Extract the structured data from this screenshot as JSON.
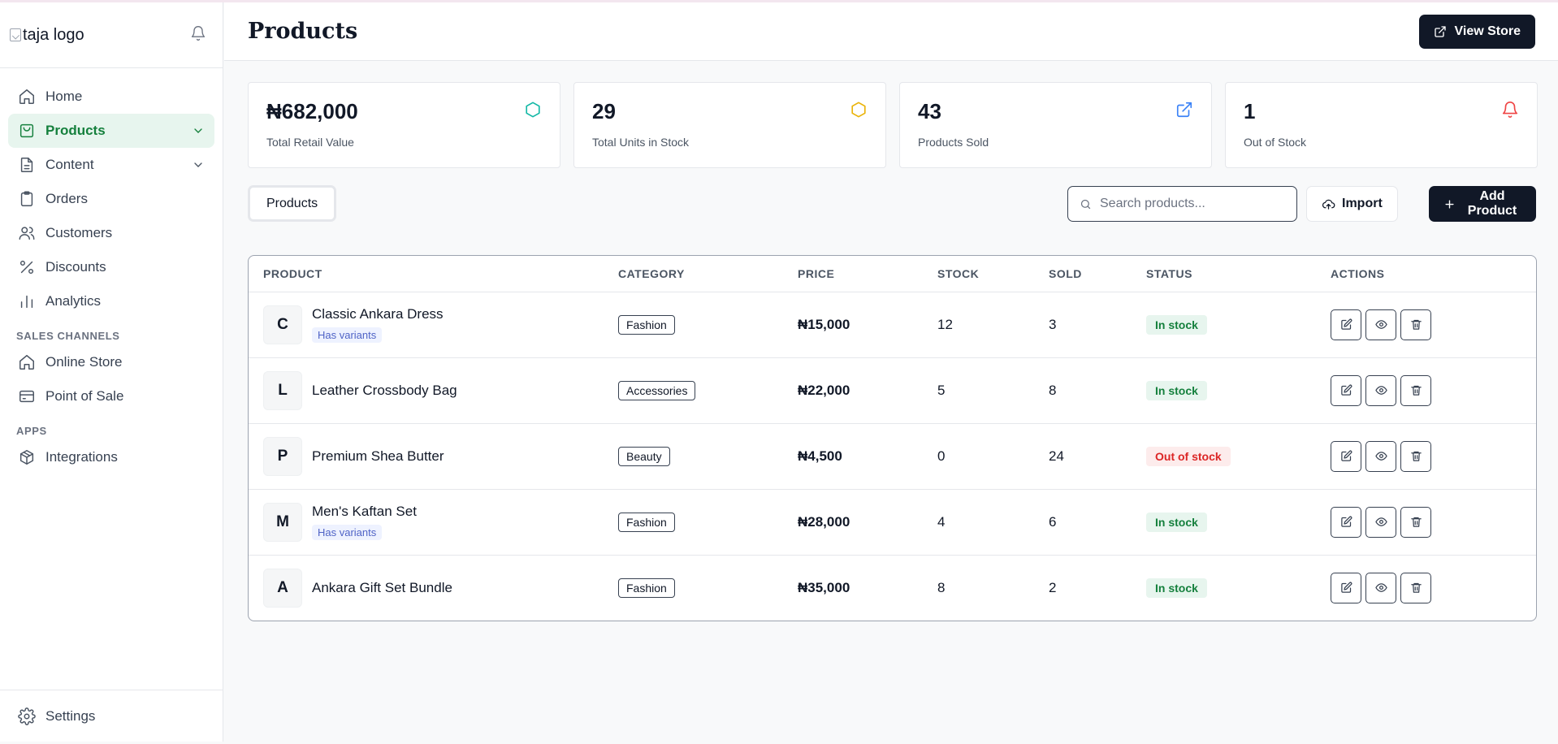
{
  "sidebar": {
    "logo_alt": "taja logo",
    "items": [
      {
        "label": "Home",
        "icon": "home-icon"
      },
      {
        "label": "Products",
        "icon": "bag-icon",
        "active": true
      },
      {
        "label": "Content",
        "icon": "document-icon"
      },
      {
        "label": "Orders",
        "icon": "clipboard-icon"
      },
      {
        "label": "Customers",
        "icon": "users-icon"
      },
      {
        "label": "Discounts",
        "icon": "percent-icon"
      },
      {
        "label": "Analytics",
        "icon": "bar-chart-icon"
      }
    ],
    "sales_channels_title": "SALES CHANNELS",
    "sales_channels": [
      {
        "label": "Online Store",
        "icon": "store-icon"
      },
      {
        "label": "Point of Sale",
        "icon": "card-icon"
      }
    ],
    "apps_title": "APPS",
    "apps": [
      {
        "label": "Integrations",
        "icon": "cube-icon"
      }
    ],
    "settings_label": "Settings"
  },
  "header": {
    "title": "Products",
    "view_store_label": "View Store"
  },
  "stats": [
    {
      "value": "₦682,000",
      "label": "Total Retail Value",
      "icon": "hexagon-icon",
      "color": "#14b8a6"
    },
    {
      "value": "29",
      "label": "Total Units in Stock",
      "icon": "hexagon-icon",
      "color": "#eab308"
    },
    {
      "value": "43",
      "label": "Products Sold",
      "icon": "external-link-icon",
      "color": "#3b82f6"
    },
    {
      "value": "1",
      "label": "Out of Stock",
      "icon": "bell-icon",
      "color": "#ef4444"
    }
  ],
  "toolbar": {
    "tab_label": "Products",
    "search_placeholder": "Search products...",
    "import_label": "Import",
    "add_label": "Add Product"
  },
  "table": {
    "headers": [
      "PRODUCT",
      "CATEGORY",
      "PRICE",
      "STOCK",
      "SOLD",
      "STATUS",
      "ACTIONS"
    ],
    "rows": [
      {
        "initial": "C",
        "name": "Classic Ankara Dress",
        "variant": "Has variants",
        "category": "Fashion",
        "price": "₦15,000",
        "stock": "12",
        "sold": "3",
        "status": "In stock"
      },
      {
        "initial": "L",
        "name": "Leather Crossbody Bag",
        "variant": "",
        "category": "Accessories",
        "price": "₦22,000",
        "stock": "5",
        "sold": "8",
        "status": "In stock"
      },
      {
        "initial": "P",
        "name": "Premium Shea Butter",
        "variant": "",
        "category": "Beauty",
        "price": "₦4,500",
        "stock": "0",
        "sold": "24",
        "status": "Out of stock"
      },
      {
        "initial": "M",
        "name": "Men's Kaftan Set",
        "variant": "Has variants",
        "category": "Fashion",
        "price": "₦28,000",
        "stock": "4",
        "sold": "6",
        "status": "In stock"
      },
      {
        "initial": "A",
        "name": "Ankara Gift Set Bundle",
        "variant": "",
        "category": "Fashion",
        "price": "₦35,000",
        "stock": "8",
        "sold": "2",
        "status": "In stock"
      }
    ]
  }
}
